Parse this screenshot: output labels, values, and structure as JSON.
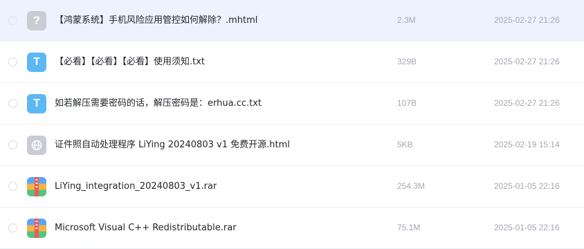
{
  "files": [
    {
      "name": "【鸿蒙系统】手机风险应用管控如何解除？.mhtml",
      "size": "2.3M",
      "date": "2025-02-27 21:26",
      "icon": "unknown-file-icon",
      "glyph": "?"
    },
    {
      "name": "【必看】【必看】【必看】使用须知.txt",
      "size": "329B",
      "date": "2025-02-27 21:26",
      "icon": "text-file-icon",
      "glyph": "T"
    },
    {
      "name": "如若解压需要密码的话，解压密码是：erhua.cc.txt",
      "size": "107B",
      "date": "2025-02-27 21:26",
      "icon": "text-file-icon",
      "glyph": "T"
    },
    {
      "name": "证件照自动处理程序 LiYing 20240803 v1 免费开源.html",
      "size": "5KB",
      "date": "2025-02-19 15:14",
      "icon": "web-file-icon"
    },
    {
      "name": "LiYing_integration_20240803_v1.rar",
      "size": "254.3M",
      "date": "2025-01-05 22:16",
      "icon": "archive-file-icon"
    },
    {
      "name": "Microsoft Visual C++ Redistributable.rar",
      "size": "75.1M",
      "date": "2025-01-05 22:16",
      "icon": "archive-file-icon"
    }
  ],
  "colors": {
    "highlight_row": "#eef2fe",
    "text_icon": "#5bb8f5",
    "generic_icon": "#c9ccd3",
    "meta_text": "#a3a8b1"
  }
}
